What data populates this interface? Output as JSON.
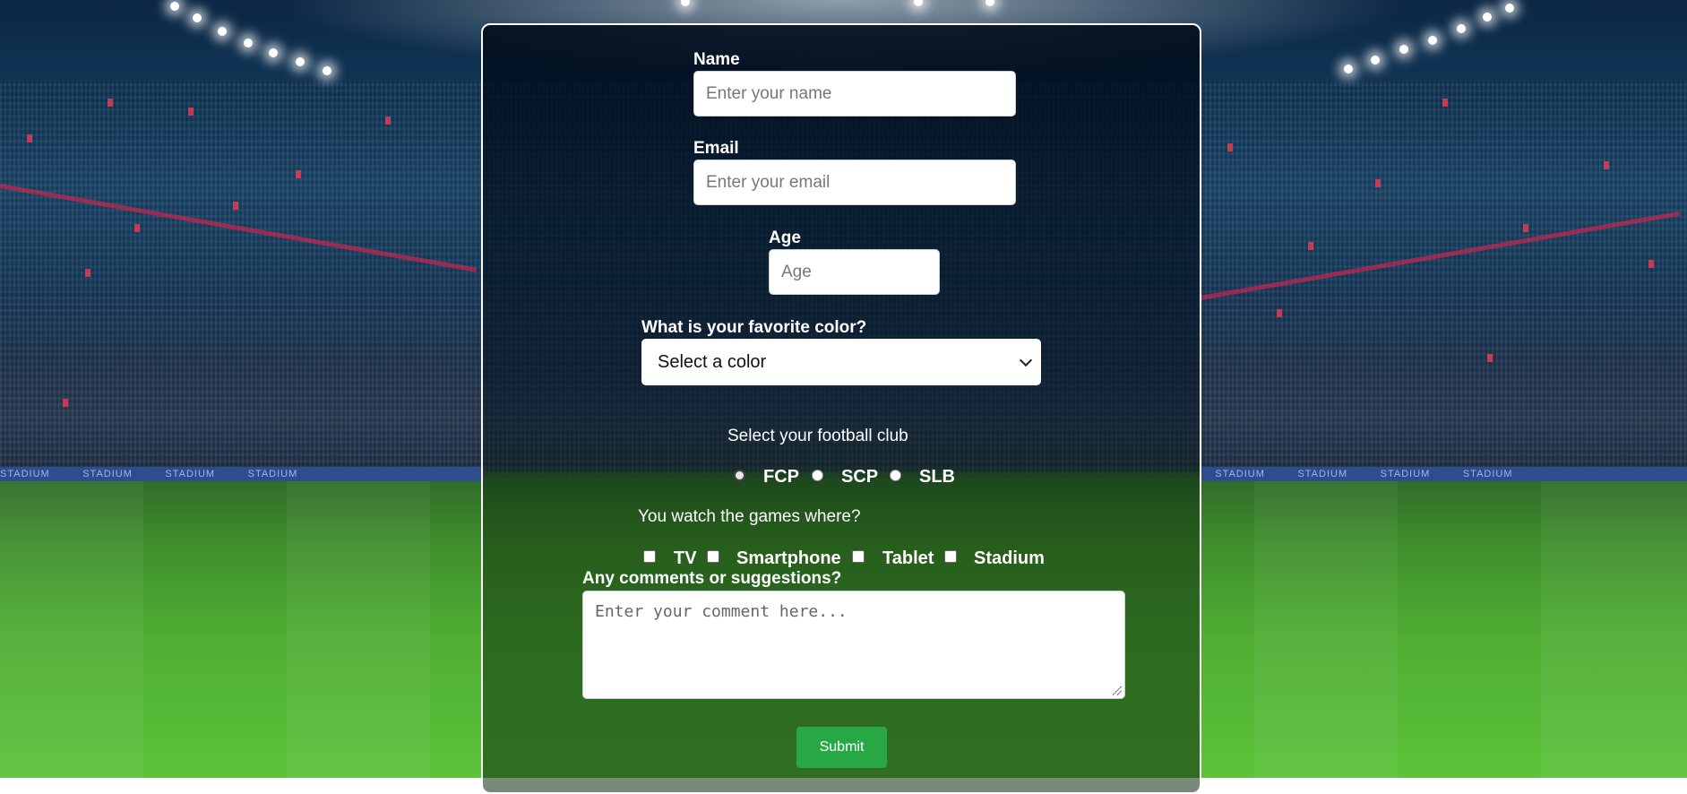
{
  "form": {
    "name": {
      "label": "Name",
      "placeholder": "Enter your name",
      "value": ""
    },
    "email": {
      "label": "Email",
      "placeholder": "Enter your email",
      "value": ""
    },
    "age": {
      "label": "Age",
      "placeholder": "Age",
      "value": ""
    },
    "color": {
      "label": "What is your favorite color?",
      "selected": "Select a color"
    },
    "club": {
      "prompt": "Select your football club",
      "options": [
        "FCP",
        "SCP",
        "SLB"
      ]
    },
    "watch": {
      "prompt": "You watch the games where?",
      "options": [
        "TV",
        "Smartphone",
        "Tablet",
        "Stadium"
      ]
    },
    "comments": {
      "label": "Any comments or suggestions?",
      "placeholder": "Enter your comment here..."
    },
    "submit_label": "Submit"
  },
  "background": {
    "ad_text": "STADIUM",
    "submit_color": "#28a745"
  }
}
